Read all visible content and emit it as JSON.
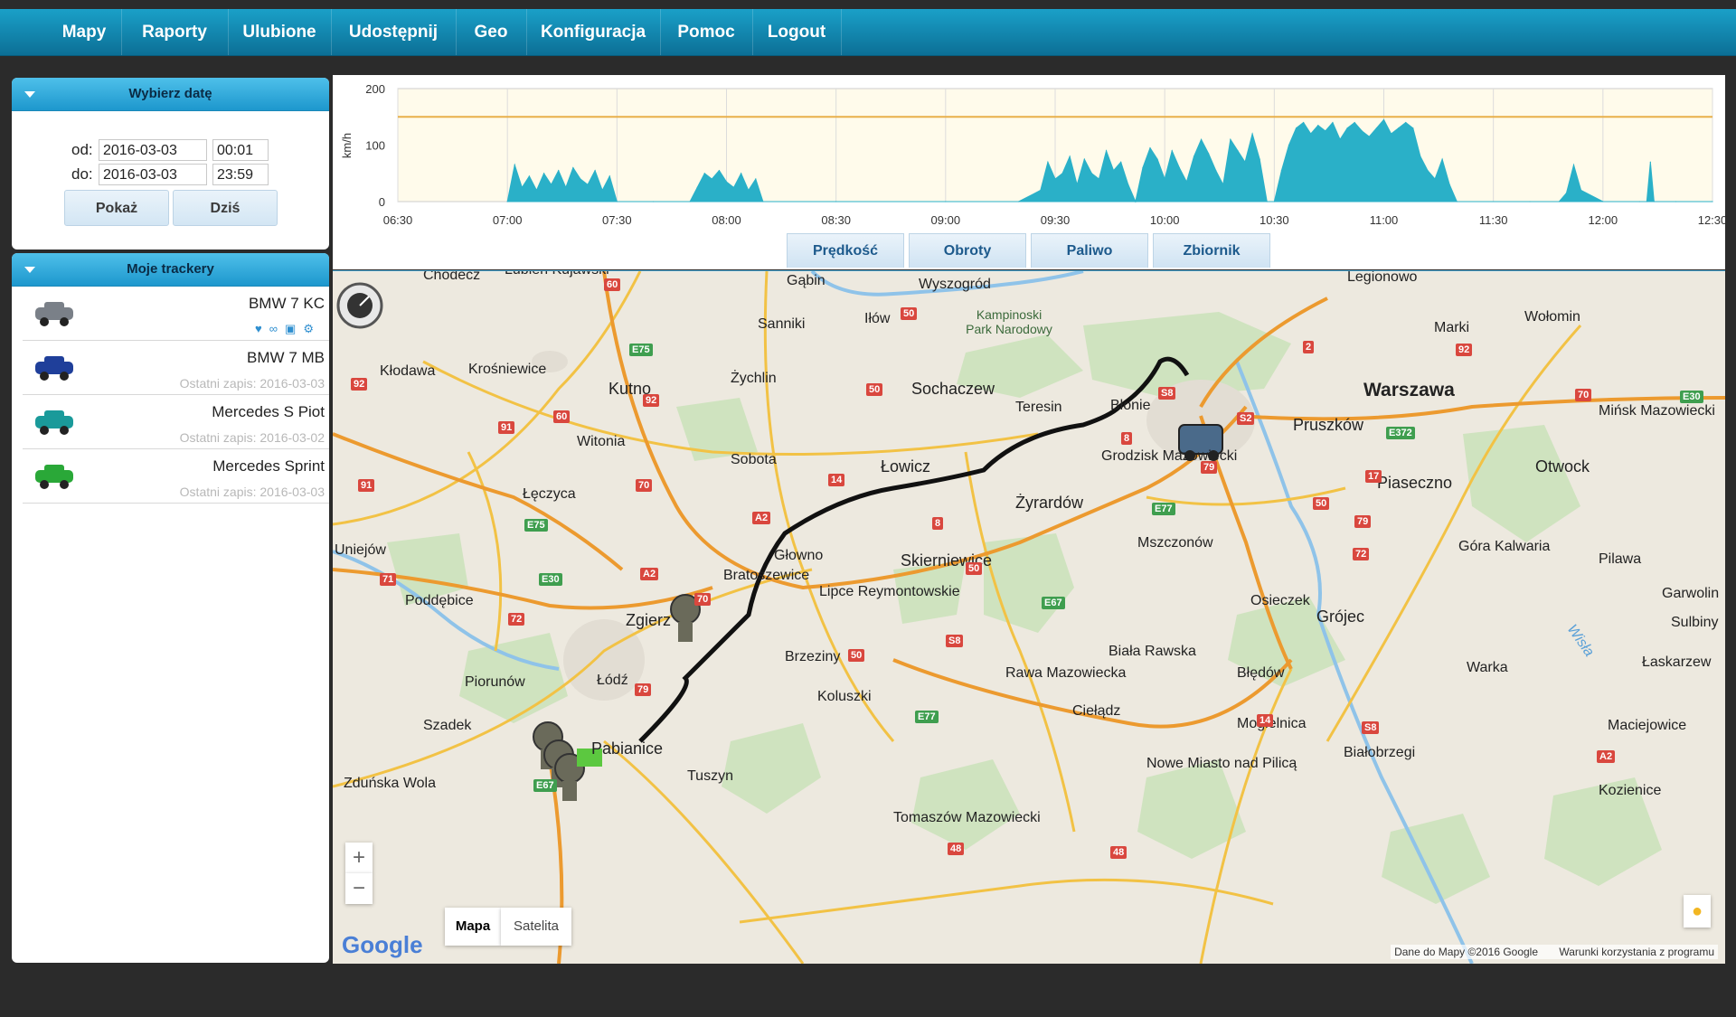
{
  "nav": {
    "items": [
      "Mapy",
      "Raporty",
      "Ulubione",
      "Udostępnij",
      "Geo",
      "Konfiguracja",
      "Pomoc",
      "Logout"
    ]
  },
  "date_panel": {
    "title": "Wybierz datę",
    "from_label": "od:",
    "to_label": "do:",
    "from_date": "2016-03-03",
    "from_time": "00:01",
    "to_date": "2016-03-03",
    "to_time": "23:59",
    "show_button": "Pokaż",
    "today_button": "Dziś"
  },
  "trackers_panel": {
    "title": "Moje trackery",
    "items": [
      {
        "name": "BMW 7 KC",
        "last": "",
        "color": "#7a8088"
      },
      {
        "name": "BMW 7 MB",
        "last": "Ostatni zapis: 2016-03-03",
        "color": "#1f3f9a"
      },
      {
        "name": "Mercedes S Piot",
        "last": "Ostatni zapis: 2016-03-02",
        "color": "#1a9a9a"
      },
      {
        "name": "Mercedes Sprint",
        "last": "Ostatni zapis: 2016-03-03",
        "color": "#2aa838"
      }
    ]
  },
  "chart": {
    "ylabel": "km/h",
    "y_ticks": [
      "200",
      "100",
      "0"
    ],
    "x_ticks": [
      "06:30",
      "07:00",
      "07:30",
      "08:00",
      "08:30",
      "09:00",
      "09:30",
      "10:00",
      "10:30",
      "11:00",
      "11:30",
      "12:00",
      "12:30"
    ],
    "colors": {
      "fill": "#2ab0c8",
      "limit": "#e8b04a",
      "bg": "#fffbeb"
    }
  },
  "chart_data": {
    "type": "area",
    "x_range": [
      "06:30",
      "12:30"
    ],
    "ylim": [
      0,
      200
    ],
    "ylabel": "km/h",
    "limit_line": 150,
    "x": [
      "07:00",
      "07:02",
      "07:04",
      "07:06",
      "07:08",
      "07:10",
      "07:12",
      "07:14",
      "07:16",
      "07:18",
      "07:20",
      "07:22",
      "07:24",
      "07:26",
      "07:28",
      "07:30",
      "07:40",
      "07:50",
      "07:52",
      "07:54",
      "07:56",
      "07:58",
      "08:00",
      "08:02",
      "08:04",
      "08:06",
      "08:08",
      "08:10",
      "08:30",
      "09:00",
      "09:20",
      "09:26",
      "09:28",
      "09:30",
      "09:32",
      "09:34",
      "09:36",
      "09:38",
      "09:40",
      "09:42",
      "09:44",
      "09:46",
      "09:48",
      "09:50",
      "09:52",
      "09:54",
      "09:56",
      "09:58",
      "10:00",
      "10:02",
      "10:04",
      "10:06",
      "10:08",
      "10:10",
      "10:12",
      "10:14",
      "10:16",
      "10:18",
      "10:20",
      "10:22",
      "10:24",
      "10:26",
      "10:28",
      "10:30",
      "10:32",
      "10:34",
      "10:36",
      "10:38",
      "10:40",
      "10:42",
      "10:44",
      "10:46",
      "10:48",
      "10:50",
      "10:52",
      "10:54",
      "10:56",
      "10:58",
      "11:00",
      "11:02",
      "11:04",
      "11:06",
      "11:08",
      "11:10",
      "11:12",
      "11:14",
      "11:16",
      "11:18",
      "11:20",
      "11:40",
      "11:48",
      "11:50",
      "11:52",
      "11:54",
      "12:00",
      "12:10",
      "12:12",
      "12:13",
      "12:14",
      "12:20",
      "12:30"
    ],
    "values": [
      0,
      65,
      25,
      45,
      20,
      50,
      30,
      55,
      25,
      60,
      40,
      30,
      55,
      20,
      45,
      0,
      0,
      0,
      25,
      50,
      40,
      55,
      35,
      25,
      50,
      20,
      40,
      0,
      0,
      0,
      0,
      20,
      70,
      40,
      50,
      80,
      30,
      75,
      50,
      40,
      90,
      55,
      70,
      30,
      0,
      60,
      95,
      75,
      40,
      90,
      60,
      35,
      80,
      110,
      85,
      55,
      30,
      110,
      90,
      70,
      120,
      75,
      0,
      0,
      55,
      100,
      130,
      140,
      120,
      135,
      125,
      140,
      110,
      130,
      140,
      125,
      115,
      130,
      145,
      120,
      130,
      140,
      130,
      80,
      55,
      40,
      75,
      30,
      0,
      0,
      0,
      15,
      65,
      20,
      0,
      0,
      0,
      70,
      0,
      0,
      0
    ]
  },
  "chart_tabs": [
    "Prędkość",
    "Obroty",
    "Paliwo",
    "Zbiornik"
  ],
  "map": {
    "places": [
      "Chodecz",
      "Lubień Kujawski",
      "Gąbin",
      "Wyszogród",
      "Legionowo",
      "Sanniki",
      "Iłów",
      "Kampinoski Park Narodowy",
      "Marki",
      "Wołomin",
      "Kłodawa",
      "Krośniewice",
      "Kutno",
      "Żychlin",
      "Sochaczew",
      "Błonie",
      "Warszawa",
      "Teresin",
      "Pruszków",
      "Mińsk Mazowiecki",
      "Witonia",
      "Sobota",
      "Łowicz",
      "Grodzisk Mazowiecki",
      "Otwock",
      "Piaseczno",
      "Łęczyca",
      "Żyrardów",
      "Uniejów",
      "Głowno",
      "Skierniewice",
      "Mszczonów",
      "Góra Kalwaria",
      "Pilawa",
      "Bratoszewice",
      "Lipce Reymontowskie",
      "Poddębice",
      "Osieczek",
      "Grójec",
      "Garwolin",
      "Zgierz",
      "Sulbiny",
      "Brzeziny",
      "Biała Rawska",
      "Łaskarzew",
      "Piorunów",
      "Łódź",
      "Koluszki",
      "Rawa Mazowiecka",
      "Błędów",
      "Warka",
      "Szadek",
      "Ciełądz",
      "Mogielnica",
      "Maciejowice",
      "Pabianice",
      "Białobrzegi",
      "Zduńska Wola",
      "Tuszyn",
      "Nowe Miasto nad Pilicą",
      "Kozienice",
      "Tomaszów Mazowiecki",
      "Wisła"
    ],
    "roads": [
      "60",
      "50",
      "E75",
      "92",
      "60",
      "91",
      "92",
      "50",
      "8",
      "E77",
      "2",
      "92",
      "70",
      "E30",
      "14",
      "A2",
      "91",
      "E75",
      "70",
      "8",
      "79",
      "17",
      "50",
      "E372",
      "72",
      "71",
      "A2",
      "E30",
      "70",
      "50",
      "79",
      "S8",
      "72",
      "50",
      "E67",
      "E77",
      "14",
      "79",
      "S8",
      "48",
      "E67",
      "48",
      "A2",
      "S2",
      "S8"
    ],
    "zoom_in": "+",
    "zoom_out": "−",
    "map_type_map": "Mapa",
    "map_type_sat": "Satelita",
    "google_logo": "Google",
    "attribution": "Dane do Mapy ©2016 Google",
    "terms": "Warunki korzystania z programu"
  }
}
